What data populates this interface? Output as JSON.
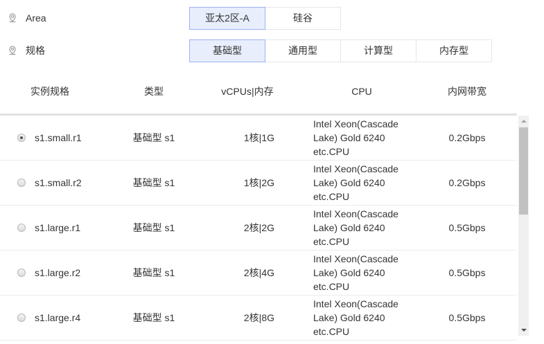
{
  "filters": [
    {
      "label": "Area",
      "options": [
        "亚太2区-A",
        "硅谷"
      ],
      "selected": 0
    },
    {
      "label": "规格",
      "options": [
        "基础型",
        "通用型",
        "计算型",
        "内存型"
      ],
      "selected": 0
    }
  ],
  "table": {
    "headers": [
      "实例规格",
      "类型",
      "vCPUs|内存",
      "CPU",
      "内网带宽"
    ],
    "rows": [
      {
        "name": "s1.small.r1",
        "type": "基础型 s1",
        "spec": "1核|1G",
        "cpu": [
          "Intel Xeon(Cascade",
          "Lake) Gold 6240",
          "etc.CPU"
        ],
        "bw": "0.2Gbps",
        "selected": true
      },
      {
        "name": "s1.small.r2",
        "type": "基础型 s1",
        "spec": "1核|2G",
        "cpu": [
          "Intel Xeon(Cascade",
          "Lake) Gold 6240",
          "etc.CPU"
        ],
        "bw": "0.2Gbps",
        "selected": false
      },
      {
        "name": "s1.large.r1",
        "type": "基础型 s1",
        "spec": "2核|2G",
        "cpu": [
          "Intel Xeon(Cascade",
          "Lake) Gold 6240",
          "etc.CPU"
        ],
        "bw": "0.5Gbps",
        "selected": false
      },
      {
        "name": "s1.large.r2",
        "type": "基础型 s1",
        "spec": "2核|4G",
        "cpu": [
          "Intel Xeon(Cascade",
          "Lake) Gold 6240",
          "etc.CPU"
        ],
        "bw": "0.5Gbps",
        "selected": false
      },
      {
        "name": "s1.large.r4",
        "type": "基础型 s1",
        "spec": "2核|8G",
        "cpu": [
          "Intel Xeon(Cascade",
          "Lake) Gold 6240",
          "etc.CPU"
        ],
        "bw": "0.5Gbps",
        "selected": false
      }
    ]
  },
  "colors": {
    "selected_bg": "#e8eefc",
    "selected_border": "#9fb0f5"
  }
}
